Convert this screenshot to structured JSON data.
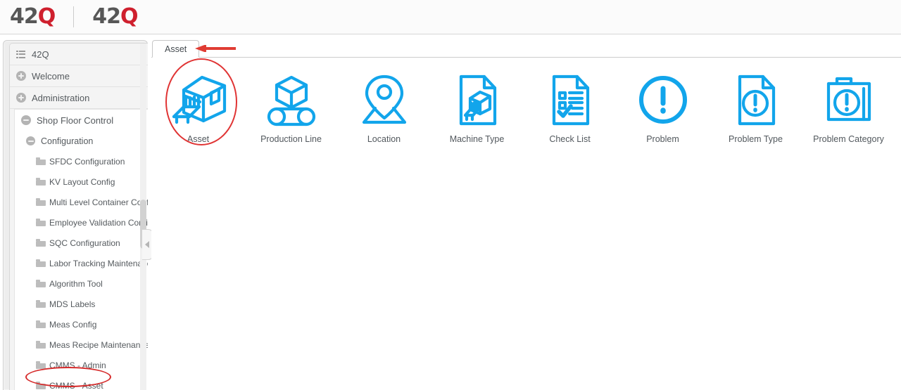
{
  "header": {
    "logo_primary": {
      "num": "42",
      "q": "Q",
      "name": "42q-logo"
    },
    "logo_secondary": {
      "num": "42",
      "q": "Q",
      "name": "42q-logo-secondary"
    },
    "brand_gray": "#575757",
    "brand_red": "#cf202e"
  },
  "sidebar": {
    "root_label": "42Q",
    "items": [
      {
        "label": "Welcome",
        "icon": "plus-circle-icon",
        "level": 0,
        "expanded": false
      },
      {
        "label": "Administration",
        "icon": "plus-circle-icon",
        "level": 0,
        "expanded": false
      },
      {
        "label": "Shop Floor Control",
        "icon": "minus-circle-icon",
        "level": 0,
        "expanded": true
      }
    ],
    "sub_group": {
      "label": "Configuration",
      "icon": "minus-circle-icon",
      "expanded": true
    },
    "leaves": [
      {
        "label": "SFDC Configuration",
        "icon": "folder-icon"
      },
      {
        "label": "KV Layout Config",
        "icon": "folder-icon"
      },
      {
        "label": "Multi Level Container Conf",
        "icon": "folder-icon"
      },
      {
        "label": "Employee Validation Confi",
        "icon": "folder-icon"
      },
      {
        "label": "SQC Configuration",
        "icon": "folder-icon"
      },
      {
        "label": "Labor Tracking Maintenanc",
        "icon": "folder-icon"
      },
      {
        "label": "Algorithm Tool",
        "icon": "folder-icon"
      },
      {
        "label": "MDS Labels",
        "icon": "folder-icon"
      },
      {
        "label": "Meas Config",
        "icon": "folder-icon"
      },
      {
        "label": "Meas Recipe Maintenance",
        "icon": "folder-icon"
      },
      {
        "label": "CMMS - Admin",
        "icon": "folder-icon"
      },
      {
        "label": "CMMS - Asset",
        "icon": "folder-icon",
        "highlighted": true
      }
    ]
  },
  "content": {
    "tabs": [
      {
        "label": "Asset",
        "active": true
      }
    ],
    "tile_color": "#12a5eb",
    "tiles": [
      {
        "label": "Asset",
        "icon": "asset-machine-icon",
        "highlighted": true
      },
      {
        "label": "Production Line",
        "icon": "conveyor-cube-icon",
        "highlighted": false
      },
      {
        "label": "Location",
        "icon": "map-pin-icon",
        "highlighted": false
      },
      {
        "label": "Machine Type",
        "icon": "document-machine-icon",
        "highlighted": false
      },
      {
        "label": "Check List",
        "icon": "document-checklist-icon",
        "highlighted": false
      },
      {
        "label": "Problem",
        "icon": "exclamation-circle-icon",
        "highlighted": false
      },
      {
        "label": "Problem Type",
        "icon": "document-exclamation-icon",
        "highlighted": false
      },
      {
        "label": "Problem Category",
        "icon": "folder-exclamation-icon",
        "highlighted": false
      }
    ]
  },
  "annotations": {
    "arrow_color": "#e03c33",
    "ellipse_color": "#e03434",
    "asset_tile_circle": "highlights the Asset tile",
    "cmms_asset_circle": "highlights the CMMS - Asset menu item",
    "tab_arrow": "points at the Asset tab"
  }
}
